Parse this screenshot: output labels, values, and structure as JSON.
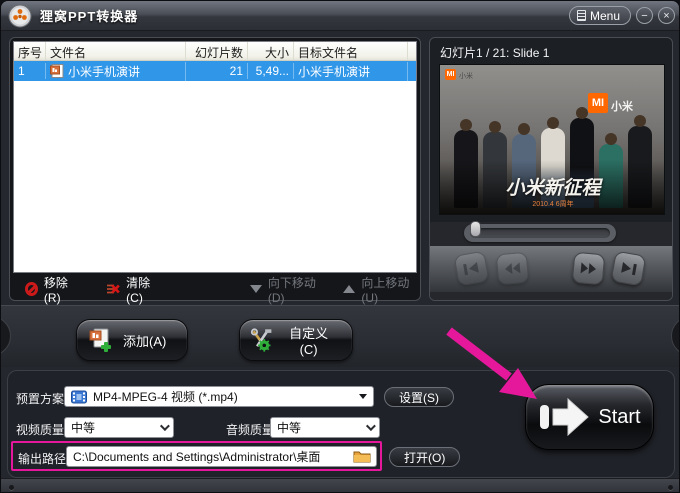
{
  "window": {
    "title": "狸窝PPT转换器",
    "menu_label": "Menu",
    "minimize_glyph": "−",
    "close_glyph": "×"
  },
  "file_table": {
    "columns": [
      "序号",
      "文件名",
      "幻灯片数",
      "大小",
      "目标文件名"
    ],
    "rows": [
      {
        "index": "1",
        "name": "小米手机演讲",
        "slides": "21",
        "size": "5,49...",
        "target": "小米手机演讲"
      }
    ]
  },
  "list_toolbar": {
    "remove": "移除(R)",
    "clear": "清除(C)",
    "move_down": "向下移动(D)",
    "move_up": "向上移动(U)"
  },
  "preview": {
    "title": "幻灯片1 / 21: Slide 1",
    "logo_text": "MI",
    "logo_brand": "小米",
    "caption": "小米新征程",
    "caption_sub": "2010.4 6周年"
  },
  "action_buttons": {
    "add": "添加(A)",
    "customize": "自定义(C)"
  },
  "settings": {
    "preset_label": "预置方案:",
    "preset_value": "MP4-MPEG-4 视频 (*.mp4)",
    "settings_button": "设置(S)",
    "video_quality_label": "视频质量:",
    "video_quality_value": "中等",
    "audio_quality_label": "音频质量:",
    "audio_quality_value": "中等",
    "output_label": "输出路径:",
    "output_value": "C:\\Documents and Settings\\Administrator\\桌面",
    "open_button": "打开(O)"
  },
  "start": {
    "label": "Start"
  },
  "colors": {
    "accent_magenta": "#e5189c",
    "selection_blue": "#2f96e8",
    "brand_orange": "#ff6700"
  }
}
